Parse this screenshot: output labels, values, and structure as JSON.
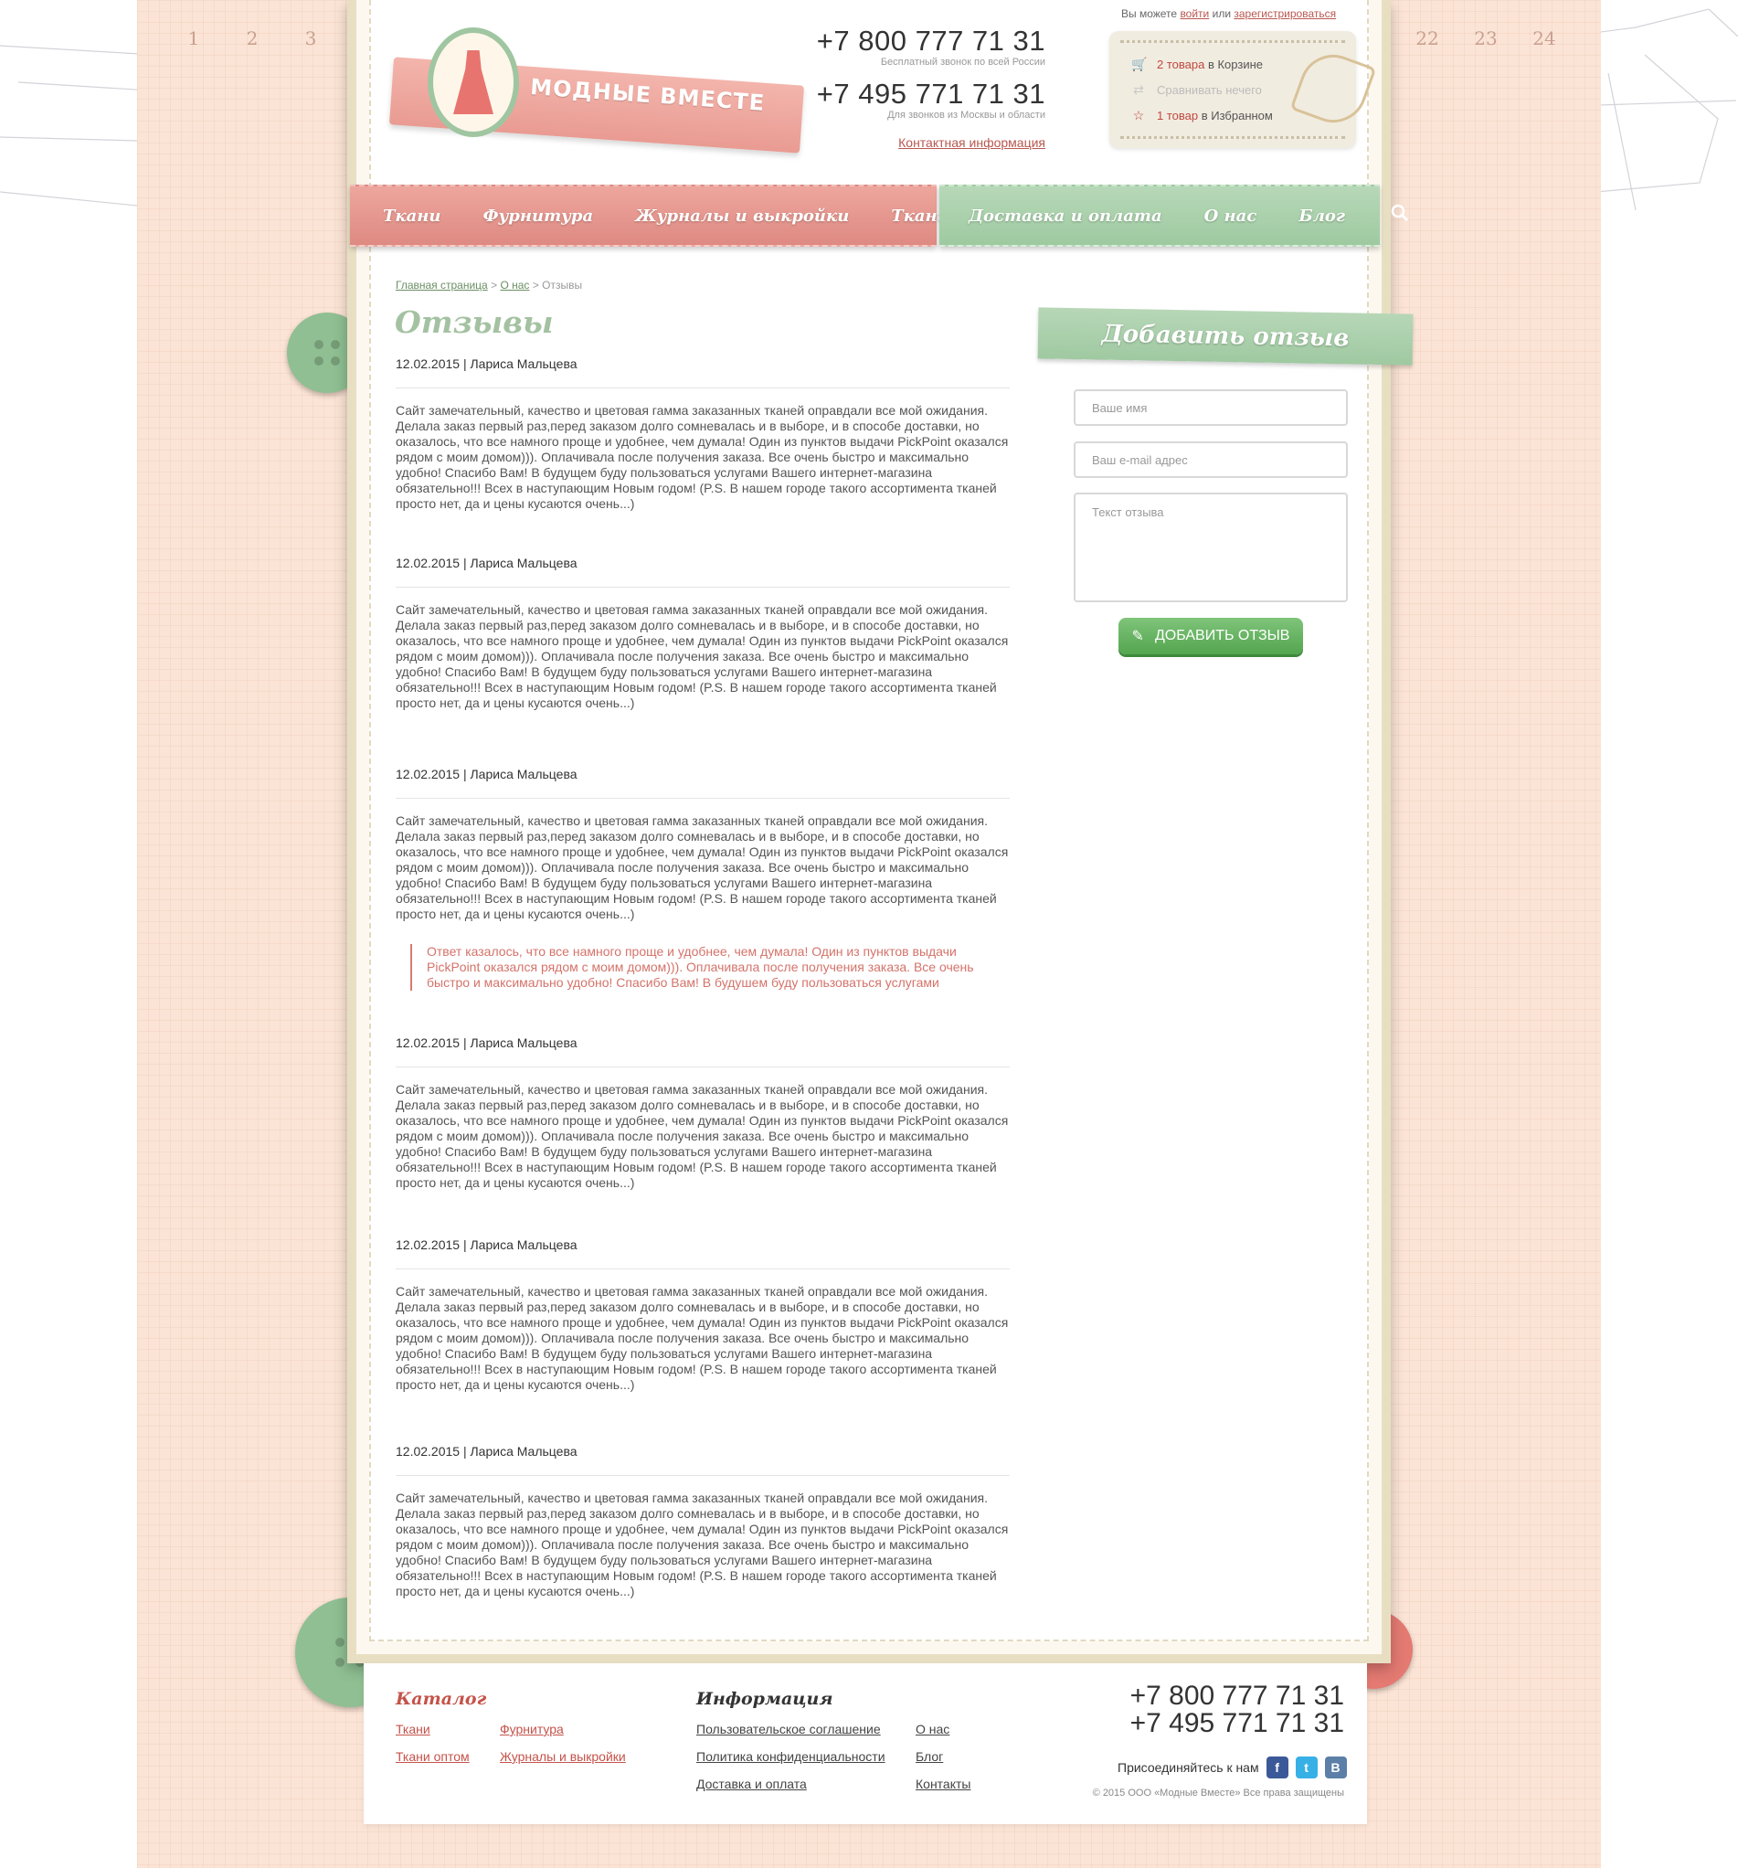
{
  "colors": {
    "background": "#fbe4d5",
    "accent_red": "#c4534a",
    "accent_green": "#9fc9a1",
    "button_green": "#53a54f"
  },
  "ruler": {
    "left": [
      "1",
      "2",
      "3"
    ],
    "right": [
      "22",
      "23",
      "24"
    ]
  },
  "logo": {
    "text": "МОДНЫЕ ВМЕСТЕ",
    "icon": "dress-icon"
  },
  "header": {
    "phone1": "+7 800 777 71 31",
    "phone1_note": "Бесплатный звонок по всей России",
    "phone2": "+7 495 771 71 31",
    "phone2_note": "Для звонков из Москвы и области",
    "contact_link": "Контактная информация",
    "account_prefix": "Вы можете",
    "login": "войти",
    "or": "или",
    "register": "зарегистрироваться"
  },
  "basket": {
    "cart_count": "2 товара",
    "cart_suffix": "в Корзине",
    "compare": "Сравнивать нечего",
    "fav_count": "1 товар",
    "fav_suffix": "в Избранном"
  },
  "nav": {
    "left": [
      "Ткани",
      "Фурнитура",
      "Журналы и выкройки",
      "Ткани оптом"
    ],
    "right": [
      "Доставка и оплата",
      "О нас",
      "Блог"
    ],
    "search_icon": "search-icon"
  },
  "breadcrumb": {
    "home": "Главная страница",
    "sep": ">",
    "about": "О нас",
    "current": "Отзывы"
  },
  "page_title": "Отзывы",
  "reviews": [
    {
      "head": "12.02.2015 | Лариса Мальцева",
      "text": "Сайт замечательный, качество и цветовая гамма заказанных тканей оправдали все мой ожидания. Делала заказ первый раз,перед заказом долго сомневалась и в выборе, и в способе доставки, но оказалось, что все намного проще и удобнее, чем думала! Один из пунктов выдачи PickPoint оказался рядом с моим домом))). Оплачивала после получения заказа. Все очень быстро и максимально удобно! Спасибо Вам! В будущем буду пользоваться услугами Вашего интернет-магазина обязательно!!! Всех в наступающим Новым годом! (P.S. В нашем городе такого ассортимента тканей просто нет, да и цены кусаются очень...)",
      "reply": ""
    },
    {
      "head": "12.02.2015 | Лариса Мальцева",
      "text": "Сайт замечательный, качество и цветовая гамма заказанных тканей оправдали все мой ожидания. Делала заказ первый раз,перед заказом долго сомневалась и в выборе, и в способе доставки, но оказалось, что все намного проще и удобнее, чем думала! Один из пунктов выдачи PickPoint оказался рядом с моим домом))). Оплачивала после получения заказа. Все очень быстро и максимально удобно! Спасибо Вам! В будущем буду пользоваться услугами Вашего интернет-магазина обязательно!!! Всех в наступающим Новым годом! (P.S. В нашем городе такого ассортимента тканей просто нет, да и цены кусаются очень...)",
      "reply": ""
    },
    {
      "head": "12.02.2015 | Лариса Мальцева",
      "text": "Сайт замечательный, качество и цветовая гамма заказанных тканей оправдали все мой ожидания. Делала заказ первый раз,перед заказом долго сомневалась и в выборе, и в способе доставки, но оказалось, что все намного проще и удобнее, чем думала! Один из пунктов выдачи PickPoint оказался рядом с моим домом))). Оплачивала после получения заказа. Все очень быстро и максимально удобно! Спасибо Вам! В будущем буду пользоваться услугами Вашего интернет-магазина обязательно!!! Всех в наступающим Новым годом! (P.S. В нашем городе такого ассортимента тканей просто нет, да и цены кусаются очень...)",
      "reply": "Ответ казалось, что все намного проще и удобнее, чем думала! Один из пунктов выдачи PickPoint оказался рядом с моим домом))). Оплачивала после получения заказа. Все очень быстро и максимально удобно! Спасибо Вам! В будушем буду пользоваться услугами"
    },
    {
      "head": "12.02.2015 | Лариса Мальцева",
      "text": "Сайт замечательный, качество и цветовая гамма заказанных тканей оправдали все мой ожидания. Делала заказ первый раз,перед заказом долго сомневалась и в выборе, и в способе доставки, но оказалось, что все намного проще и удобнее, чем думала! Один из пунктов выдачи PickPoint оказался рядом с моим домом))). Оплачивала после получения заказа. Все очень быстро и максимально удобно! Спасибо Вам! В будущем буду пользоваться услугами Вашего интернет-магазина обязательно!!! Всех в наступающим Новым годом! (P.S. В нашем городе такого ассортимента тканей просто нет, да и цены кусаются очень...)",
      "reply": ""
    },
    {
      "head": "12.02.2015 | Лариса Мальцева",
      "text": "Сайт замечательный, качество и цветовая гамма заказанных тканей оправдали все мой ожидания. Делала заказ первый раз,перед заказом долго сомневалась и в выборе, и в способе доставки, но оказалось, что все намного проще и удобнее, чем думала! Один из пунктов выдачи PickPoint оказался рядом с моим домом))). Оплачивала после получения заказа. Все очень быстро и максимально удобно! Спасибо Вам! В будущем буду пользоваться услугами Вашего интернет-магазина обязательно!!! Всех в наступающим Новым годом! (P.S. В нашем городе такого ассортимента тканей просто нет, да и цены кусаются очень...)",
      "reply": ""
    },
    {
      "head": "12.02.2015 | Лариса Мальцева",
      "text": "Сайт замечательный, качество и цветовая гамма заказанных тканей оправдали все мой ожидания. Делала заказ первый раз,перед заказом долго сомневалась и в выборе, и в способе доставки, но оказалось, что все намного проще и удобнее, чем думала! Один из пунктов выдачи PickPoint оказался рядом с моим домом))). Оплачивала после получения заказа. Все очень быстро и максимально удобно! Спасибо Вам! В будущем буду пользоваться услугами Вашего интернет-магазина обязательно!!! Всех в наступающим Новым годом! (P.S. В нашем городе такого ассортимента тканей просто нет, да и цены кусаются очень...)",
      "reply": ""
    }
  ],
  "add_review": {
    "title": "Добавить отзыв",
    "name_placeholder": "Ваше имя",
    "email_placeholder": "Ваш e-mail адрес",
    "text_placeholder": "Текст отзыва",
    "button": "ДОБАВИТЬ ОТЗЫВ",
    "button_icon": "pencil-icon"
  },
  "footer": {
    "catalog_title": "Каталог",
    "catalog_links": [
      "Ткани",
      "Фурнитура",
      "Ткани оптом",
      "Журналы и выкройки"
    ],
    "info_title": "Информация",
    "info_links": [
      "Пользовательское соглашение",
      "О нас",
      "Политика конфиденциальности",
      "Блог",
      "Доставка и оплата",
      "Контакты"
    ],
    "phone1": "+7 800 777 71 31",
    "phone2": "+7 495 771 71 31",
    "join": "Присоединяйтесь к нам",
    "social": [
      "f",
      "t",
      "B"
    ],
    "copyright": "© 2015 ООО «Модные Вместе» Все права защищены"
  }
}
